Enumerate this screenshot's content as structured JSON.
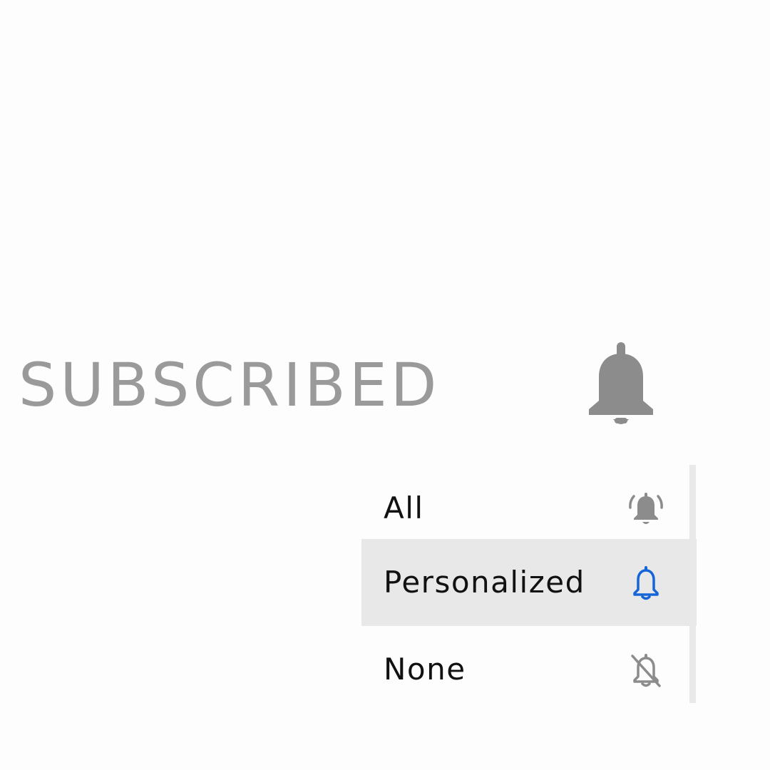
{
  "subscription": {
    "status_label": "SUBSCRIBED",
    "bell_icon": "bell-filled-icon",
    "label_color": "#9a9a9a",
    "bell_color": "#8c8c8c"
  },
  "notification_menu": {
    "selected": "Personalized",
    "items": [
      {
        "label": "All",
        "icon": "bell-ringing-icon",
        "icon_color": "#8c8c8c"
      },
      {
        "label": "Personalized",
        "icon": "bell-outline-icon",
        "icon_color": "#1565d8"
      },
      {
        "label": "None",
        "icon": "bell-off-icon",
        "icon_color": "#8c8c8c"
      }
    ],
    "highlight_color": "#e8e8e8"
  }
}
